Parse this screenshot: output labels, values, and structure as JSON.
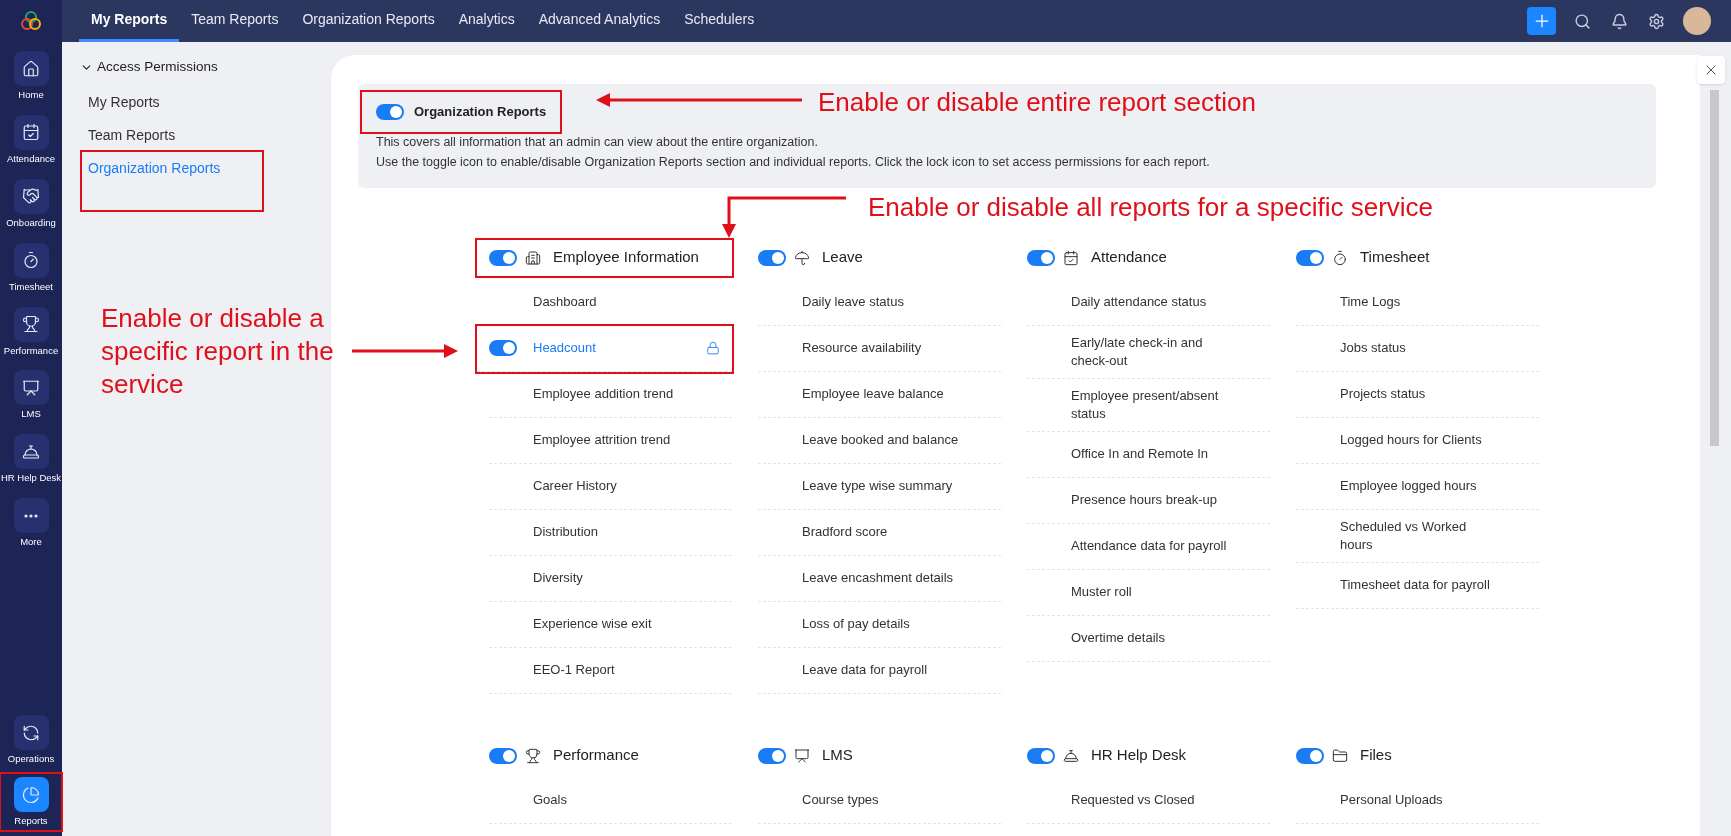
{
  "top_nav": {
    "tabs": [
      {
        "label": "My Reports",
        "selected": true
      },
      {
        "label": "Team Reports",
        "selected": false
      },
      {
        "label": "Organization Reports",
        "selected": false
      },
      {
        "label": "Analytics",
        "selected": false
      },
      {
        "label": "Advanced Analytics",
        "selected": false
      },
      {
        "label": "Schedulers",
        "selected": false
      }
    ]
  },
  "rail": {
    "items": [
      {
        "label": "Home",
        "kind": "home",
        "selected": false,
        "highlighted": false
      },
      {
        "label": "Attendance",
        "kind": "calendar",
        "selected": false,
        "highlighted": false
      },
      {
        "label": "Onboarding",
        "kind": "handshake",
        "selected": false,
        "highlighted": false
      },
      {
        "label": "Timesheet",
        "kind": "timer",
        "selected": false,
        "highlighted": false
      },
      {
        "label": "Performance",
        "kind": "trophy",
        "selected": false,
        "highlighted": false
      },
      {
        "label": "LMS",
        "kind": "board",
        "selected": false,
        "highlighted": false
      },
      {
        "label": "HR Help Desk",
        "kind": "bell",
        "selected": false,
        "highlighted": false
      },
      {
        "label": "More",
        "kind": "more",
        "selected": false,
        "highlighted": false
      }
    ],
    "bottom_items": [
      {
        "label": "Operations",
        "kind": "cycle",
        "selected": false,
        "highlighted": false
      },
      {
        "label": "Reports",
        "kind": "pie",
        "selected": true,
        "highlighted": true
      }
    ]
  },
  "sidebar": {
    "group": "Access Permissions",
    "expanded": true,
    "items": [
      {
        "label": "My Reports",
        "selected": false,
        "highlighted": false
      },
      {
        "label": "Team Reports",
        "selected": false,
        "highlighted": false
      },
      {
        "label": "Organization Reports",
        "selected": true,
        "highlighted": true
      }
    ]
  },
  "header": {
    "title": "Organization Reports",
    "on": true,
    "highlighted": true,
    "description": [
      "This covers all information that an admin can view about the entire organization.",
      "Use the toggle icon to enable/disable Organization Reports section and individual reports. Click the lock icon to set access permissions for each report."
    ]
  },
  "services": [
    {
      "title": "Employee Information",
      "kind": "building",
      "on": true,
      "highlighted": true,
      "items": [
        {
          "label": "Dashboard",
          "kind": "plain"
        },
        {
          "label": "Headcount",
          "kind": "toggle",
          "on": true,
          "highlighted": true
        },
        {
          "label": "Employee addition trend",
          "kind": "plain"
        },
        {
          "label": "Employee attrition trend",
          "kind": "plain"
        },
        {
          "label": "Career History",
          "kind": "plain"
        },
        {
          "label": "Distribution",
          "kind": "plain"
        },
        {
          "label": "Diversity",
          "kind": "plain"
        },
        {
          "label": "Experience wise exit",
          "kind": "plain"
        },
        {
          "label": "EEO-1 Report",
          "kind": "plain"
        }
      ]
    },
    {
      "title": "Leave",
      "kind": "umbrella",
      "on": true,
      "highlighted": false,
      "items": [
        {
          "label": "Daily leave status",
          "kind": "plain"
        },
        {
          "label": "Resource availability",
          "kind": "plain"
        },
        {
          "label": "Employee leave balance",
          "kind": "plain"
        },
        {
          "label": "Leave booked and balance",
          "kind": "plain"
        },
        {
          "label": "Leave type wise summary",
          "kind": "plain"
        },
        {
          "label": "Bradford score",
          "kind": "plain"
        },
        {
          "label": "Leave encashment details",
          "kind": "plain"
        },
        {
          "label": "Loss of pay details",
          "kind": "plain"
        },
        {
          "label": "Leave data for payroll",
          "kind": "plain"
        }
      ]
    },
    {
      "title": "Attendance",
      "kind": "calendar",
      "on": true,
      "highlighted": false,
      "items": [
        {
          "label": "Daily attendance status",
          "kind": "plain"
        },
        {
          "label": "Early/late check-in and check-out",
          "kind": "plain"
        },
        {
          "label": "Employee present/absent status",
          "kind": "plain"
        },
        {
          "label": "Office In and Remote In",
          "kind": "plain"
        },
        {
          "label": "Presence hours break-up",
          "kind": "plain"
        },
        {
          "label": "Attendance data for payroll",
          "kind": "plain"
        },
        {
          "label": "Muster roll",
          "kind": "plain"
        },
        {
          "label": "Overtime details",
          "kind": "plain"
        }
      ]
    },
    {
      "title": "Timesheet",
      "kind": "timer",
      "on": true,
      "highlighted": false,
      "items": [
        {
          "label": "Time Logs",
          "kind": "plain"
        },
        {
          "label": "Jobs status",
          "kind": "plain"
        },
        {
          "label": "Projects status",
          "kind": "plain"
        },
        {
          "label": "Logged hours for Clients",
          "kind": "plain"
        },
        {
          "label": "Employee logged hours",
          "kind": "plain"
        },
        {
          "label": "Scheduled vs Worked hours",
          "kind": "plain"
        },
        {
          "label": "Timesheet data for payroll",
          "kind": "plain"
        }
      ]
    },
    {
      "title": "Performance",
      "kind": "trophy",
      "on": true,
      "highlighted": false,
      "items": [
        {
          "label": "Goals",
          "kind": "plain"
        }
      ]
    },
    {
      "title": "LMS",
      "kind": "board",
      "on": true,
      "highlighted": false,
      "items": [
        {
          "label": "Course types",
          "kind": "plain"
        }
      ]
    },
    {
      "title": "HR Help Desk",
      "kind": "bell",
      "on": true,
      "highlighted": false,
      "items": [
        {
          "label": "Requested vs Closed",
          "kind": "plain"
        }
      ]
    },
    {
      "title": "Files",
      "kind": "folder",
      "on": true,
      "highlighted": false,
      "items": [
        {
          "label": "Personal Uploads",
          "kind": "plain"
        }
      ]
    }
  ],
  "annotations": [
    {
      "text": "Enable or disable entire report section"
    },
    {
      "text": "Enable or disable all reports for a specific service"
    },
    {
      "text": "Enable or disable a specific report in the service"
    }
  ]
}
